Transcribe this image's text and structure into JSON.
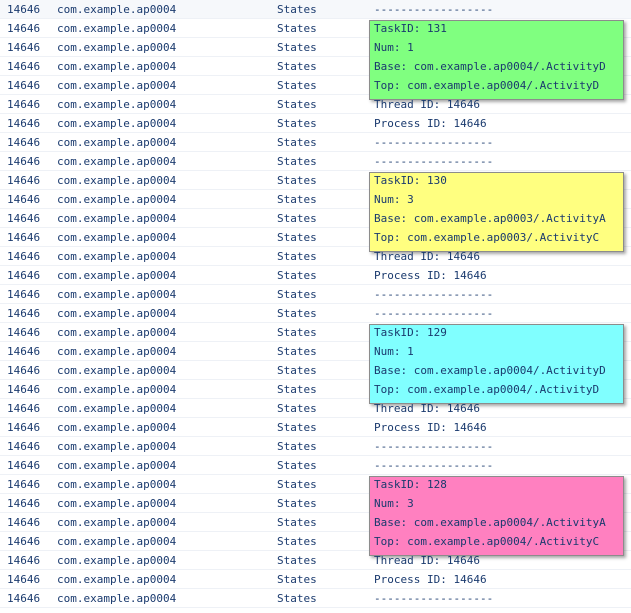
{
  "columns": {
    "pid": "14646",
    "app": "com.example.ap0004",
    "tag": "States"
  },
  "rows": [
    "------------------",
    "TaskID: 131",
    "Num: 1",
    "Base: com.example.ap0004/.ActivityD",
    "Top: com.example.ap0004/.ActivityD",
    "Thread ID: 14646",
    "Process ID: 14646",
    "------------------",
    "------------------",
    "TaskID: 130",
    "Num: 3",
    "Base: com.example.ap0003/.ActivityA",
    "Top: com.example.ap0003/.ActivityC",
    "Thread ID: 14646",
    "Process ID: 14646",
    "------------------",
    "------------------",
    "TaskID: 129",
    "Num: 1",
    "Base: com.example.ap0004/.ActivityD",
    "Top: com.example.ap0004/.ActivityD",
    "Thread ID: 14646",
    "Process ID: 14646",
    "------------------",
    "------------------",
    "TaskID: 128",
    "Num: 3",
    "Base: com.example.ap0004/.ActivityA",
    "Top: com.example.ap0004/.ActivityC",
    "Thread ID: 14646",
    "Process ID: 14646",
    "------------------"
  ],
  "highlights": [
    {
      "task": "TaskID: 131",
      "color": "#80ff80"
    },
    {
      "task": "TaskID: 130",
      "color": "#ffff80"
    },
    {
      "task": "TaskID: 129",
      "color": "#80ffff"
    },
    {
      "task": "TaskID: 128",
      "color": "#ff80c0"
    }
  ]
}
